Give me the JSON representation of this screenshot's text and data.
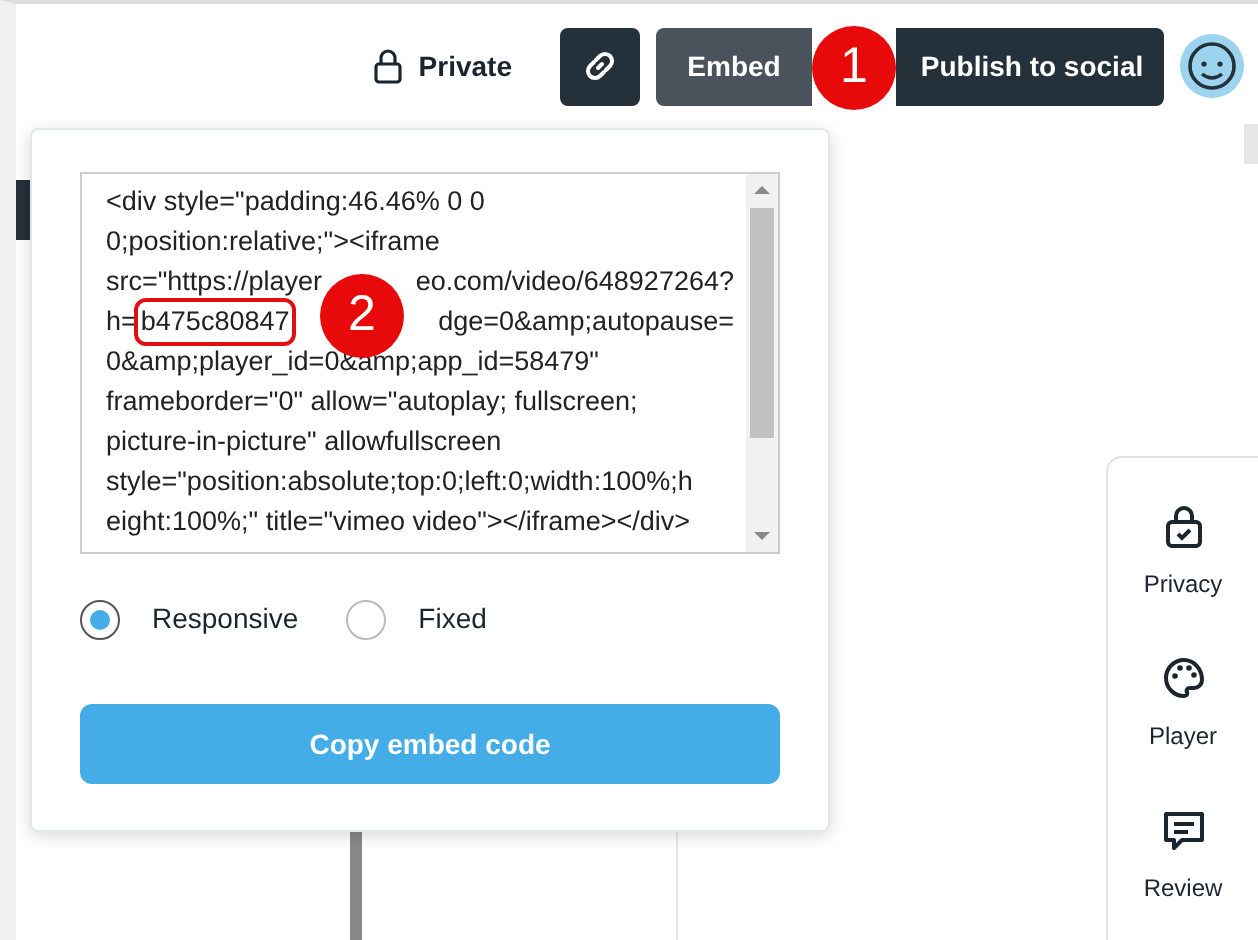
{
  "header": {
    "privacy_label": "Private",
    "embed_button": "Embed",
    "publish_button": "Publish to social"
  },
  "embed_popup": {
    "code_lines": [
      {
        "parts": [
          "<div style=\"padding:46.46% 0 0"
        ]
      },
      {
        "parts": [
          "0;position:relative;\"><iframe"
        ]
      },
      {
        "parts": [
          "src=\"https://player",
          "eo.com/video/648927264?"
        ]
      },
      {
        "parts": [
          "h=",
          "b475c80847",
          "dge=0&amp;autopause="
        ],
        "highlighted": [
          false,
          true,
          false
        ]
      },
      {
        "parts": [
          "0&amp;player_id=0&amp;app_id=58479\""
        ]
      },
      {
        "parts": [
          "frameborder=\"0\" allow=\"autoplay; fullscreen;"
        ]
      },
      {
        "parts": [
          "picture-in-picture\" allowfullscreen"
        ]
      },
      {
        "parts": [
          "style=\"position:absolute;top:0;left:0;width:100%;h"
        ]
      },
      {
        "parts": [
          "eight:100%;\" title=\"vimeo video\"></iframe></div>"
        ]
      }
    ],
    "size_options": [
      {
        "label": "Responsive",
        "selected": true
      },
      {
        "label": "Fixed",
        "selected": false
      }
    ],
    "copy_button": "Copy embed code"
  },
  "side_panel": [
    {
      "kind": "privacy",
      "label": "Privacy"
    },
    {
      "kind": "player",
      "label": "Player"
    },
    {
      "kind": "review",
      "label": "Review"
    }
  ],
  "callouts": [
    "1",
    "2"
  ]
}
